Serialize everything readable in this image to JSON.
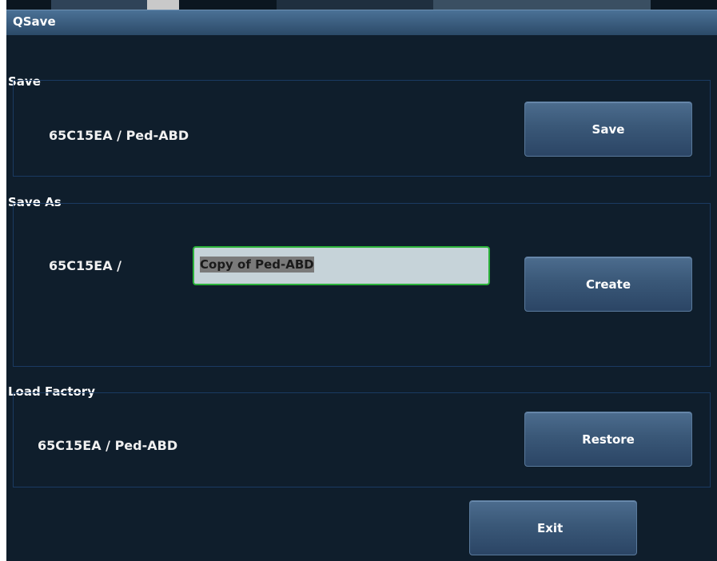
{
  "window": {
    "title": "QSave"
  },
  "save_section": {
    "label": "Save",
    "preset": "65C15EA / Ped-ABD",
    "button_label": "Save"
  },
  "save_as_section": {
    "label": "Save As",
    "probe": "65C15EA /",
    "name_value": "Copy of Ped-ABD",
    "button_label": "Create"
  },
  "load_factory_section": {
    "label": "Load Factory",
    "preset": "65C15EA / Ped-ABD",
    "button_label": "Restore"
  },
  "footer": {
    "exit_label": "Exit"
  },
  "colors": {
    "background": "#0f1e2c",
    "titlebar": "#3b5d80",
    "button": "#3a5878",
    "input_focus_border": "#2bb23a",
    "input_fill": "#c6d3d9"
  }
}
